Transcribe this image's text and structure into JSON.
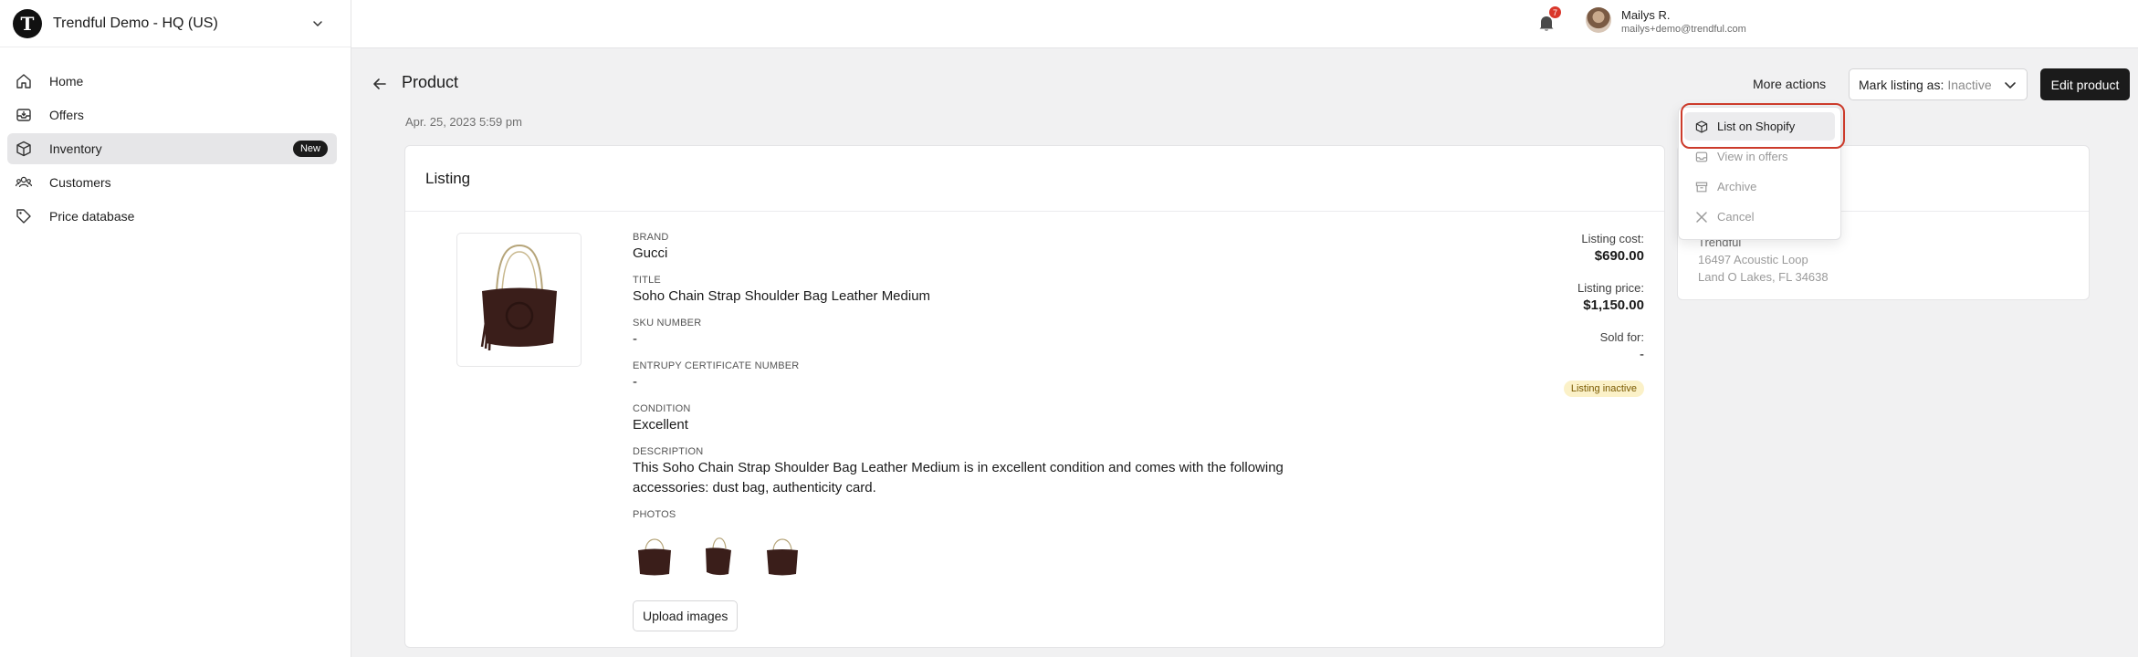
{
  "org": {
    "logo_letter": "T",
    "name": "Trendful Demo - HQ (US)"
  },
  "sidebar": {
    "items": [
      {
        "label": "Home",
        "icon": "home-icon"
      },
      {
        "label": "Offers",
        "icon": "inbox-icon"
      },
      {
        "label": "Inventory",
        "icon": "box-icon",
        "badge": "New",
        "active": true
      },
      {
        "label": "Customers",
        "icon": "users-icon"
      },
      {
        "label": "Price database",
        "icon": "tag-icon"
      }
    ]
  },
  "topbar": {
    "notification_count": "7",
    "user": {
      "name": "Mailys R.",
      "email": "mailys+demo@trendful.com"
    }
  },
  "header": {
    "title": "Product",
    "date": "Apr. 25, 2023 5:59 pm",
    "more_actions": "More actions",
    "mark_listing_label": "Mark listing as:",
    "mark_listing_value": "Inactive",
    "edit_button": "Edit product"
  },
  "dropdown": {
    "items": [
      {
        "label": "List on Shopify",
        "icon": "box-icon",
        "active": true
      },
      {
        "label": "View in offers",
        "icon": "inbox-icon"
      },
      {
        "label": "Archive",
        "icon": "archive-icon"
      },
      {
        "label": "Cancel",
        "icon": "close-icon"
      }
    ]
  },
  "listing": {
    "card_title": "Listing",
    "fields": {
      "brand_label": "BRAND",
      "brand": "Gucci",
      "title_label": "TITLE",
      "title": "Soho Chain Strap Shoulder Bag Leather Medium",
      "sku_label": "SKU NUMBER",
      "sku": "-",
      "entrupy_label": "ENTRUPY CERTIFICATE NUMBER",
      "entrupy": "-",
      "condition_label": "CONDITION",
      "condition": "Excellent",
      "description_label": "DESCRIPTION",
      "description": "This Soho Chain Strap Shoulder Bag Leather Medium is in excellent condition and comes with the following accessories: dust bag, authenticity card.",
      "photos_label": "PHOTOS"
    },
    "upload_button": "Upload images",
    "prices": {
      "cost_label": "Listing cost:",
      "cost": "$690.00",
      "price_label": "Listing price:",
      "price": "$1,150.00",
      "sold_label": "Sold for:",
      "sold": "-",
      "status": "Listing inactive"
    },
    "colors": {
      "bag": "#3a1e1a",
      "status_bg": "#fbf1c8",
      "highlight": "#cc3b2b"
    }
  },
  "location": {
    "name": "Trendful",
    "street": "16497 Acoustic Loop",
    "city": "Land O Lakes, FL 34638"
  }
}
